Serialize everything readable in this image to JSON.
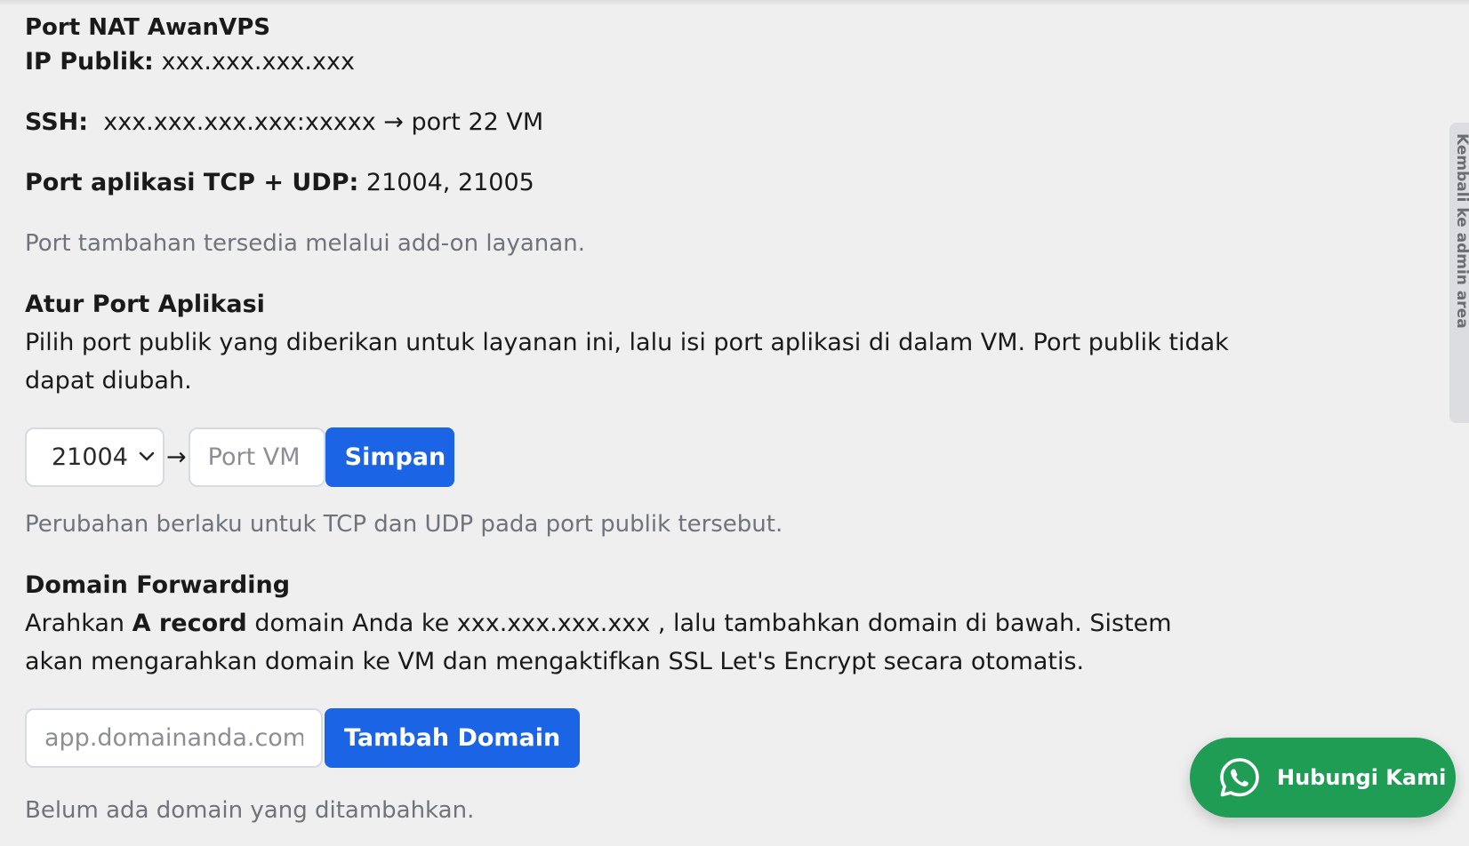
{
  "nat": {
    "title": "Port NAT AwanVPS",
    "ip_label": "IP Publik:",
    "ip_value": "xxx.xxx.xxx.xxx",
    "ssh_label": "SSH:",
    "ssh_value": "xxx.xxx.xxx.xxx:xxxxx → port 22 VM",
    "ports_label": "Port aplikasi TCP + UDP:",
    "ports_value": "21004, 21005",
    "addon_note": "Port tambahan tersedia melalui add-on layanan."
  },
  "port_app": {
    "heading": "Atur Port Aplikasi",
    "description": "Pilih port publik yang diberikan untuk layanan ini, lalu isi port aplikasi di dalam VM. Port publik tidak dapat diubah.",
    "selected_port": "21004",
    "arrow": "→",
    "vm_port_placeholder": "Port VM",
    "save_label": "Simpan",
    "note": "Perubahan berlaku untuk TCP dan UDP pada port publik tersebut."
  },
  "domain": {
    "heading": "Domain Forwarding",
    "desc_prefix": "Arahkan ",
    "desc_bold": "A record",
    "desc_suffix": " domain Anda ke xxx.xxx.xxx.xxx , lalu tambahkan domain di bawah. Sistem akan mengarahkan domain ke VM dan mengaktifkan SSL Let's Encrypt secara otomatis.",
    "input_placeholder": "app.domainanda.com",
    "add_label": "Tambah Domain",
    "empty_note": "Belum ada domain yang ditambahkan."
  },
  "side_tab": {
    "label": "Kembali ke admin area"
  },
  "whatsapp": {
    "label": "Hubungi Kami",
    "icon": "whatsapp-icon",
    "color": "#1f9d55"
  },
  "colors": {
    "accent": "#1c64e6",
    "background": "#efeff0",
    "muted_text": "#6f747a"
  }
}
